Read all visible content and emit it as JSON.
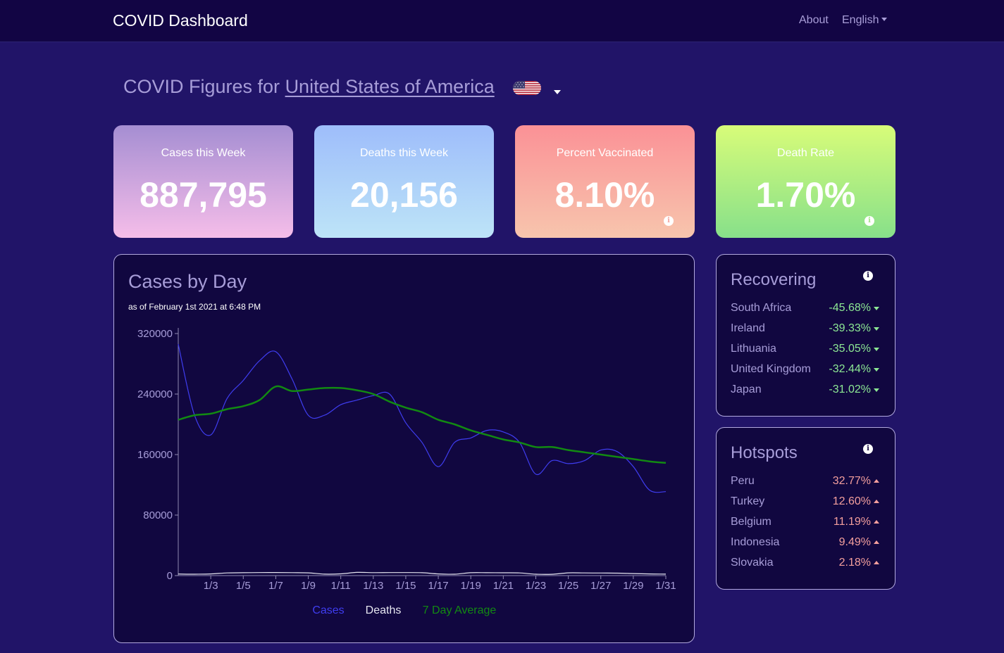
{
  "nav": {
    "brand": "COVID Dashboard",
    "about": "About",
    "language": "English"
  },
  "heading": {
    "prefix": "COVID Figures for ",
    "country": "United States of America",
    "flag_icon": "us-flag-icon"
  },
  "cards": {
    "cases": {
      "label": "Cases this Week",
      "value": "887,795"
    },
    "deaths": {
      "label": "Deaths this Week",
      "value": "20,156"
    },
    "vaccinated": {
      "label": "Percent Vaccinated",
      "value": "8.10%"
    },
    "death_rate": {
      "label": "Death Rate",
      "value": "1.70%"
    },
    "info_glyph": "i"
  },
  "chart_panel": {
    "title": "Cases by Day",
    "subtitle": "as of February 1st 2021 at 6:48 PM"
  },
  "chart_data": {
    "type": "line",
    "title": "Cases by Day",
    "x": [
      "1/1",
      "1/2",
      "1/3",
      "1/4",
      "1/5",
      "1/6",
      "1/7",
      "1/8",
      "1/9",
      "1/10",
      "1/11",
      "1/12",
      "1/13",
      "1/14",
      "1/15",
      "1/16",
      "1/17",
      "1/18",
      "1/19",
      "1/20",
      "1/21",
      "1/22",
      "1/23",
      "1/24",
      "1/25",
      "1/26",
      "1/27",
      "1/28",
      "1/29",
      "1/30",
      "1/31"
    ],
    "xticks": [
      "1/3",
      "1/5",
      "1/7",
      "1/9",
      "1/11",
      "1/13",
      "1/15",
      "1/17",
      "1/19",
      "1/21",
      "1/23",
      "1/25",
      "1/27",
      "1/29",
      "1/31"
    ],
    "yticks": [
      0,
      80000,
      160000,
      240000,
      320000
    ],
    "ylim": [
      0,
      320000
    ],
    "grid": false,
    "legend_position": "bottom",
    "series": [
      {
        "name": "Cases",
        "color": "#3f3df0",
        "values": [
          306000,
          212000,
          186000,
          234000,
          258000,
          284000,
          296000,
          260000,
          212000,
          212000,
          226000,
          232000,
          238000,
          240000,
          202000,
          176000,
          144000,
          176000,
          182000,
          192000,
          190000,
          176000,
          134000,
          152000,
          148000,
          152000,
          166000,
          164000,
          144000,
          113000,
          111000
        ]
      },
      {
        "name": "Deaths",
        "color": "#e6e6f0",
        "values": [
          2100,
          1900,
          2200,
          3500,
          3800,
          4000,
          4100,
          3900,
          3600,
          2000,
          2300,
          4300,
          3900,
          4000,
          4000,
          3800,
          2200,
          1900,
          3800,
          3800,
          3700,
          3500,
          1900,
          1800,
          3600,
          3500,
          3400,
          3300,
          2700,
          2200,
          2000
        ]
      },
      {
        "name": "7 Day Average",
        "color": "#128a12",
        "values": [
          206000,
          212000,
          214000,
          220000,
          224000,
          232000,
          250000,
          244000,
          246000,
          248000,
          248000,
          245000,
          240000,
          230000,
          222000,
          216000,
          206000,
          200000,
          192000,
          186000,
          180000,
          176000,
          170000,
          170000,
          166000,
          163000,
          160000,
          157000,
          154000,
          151000,
          149000
        ]
      }
    ]
  },
  "recovering": {
    "title": "Recovering",
    "items": [
      {
        "name": "South Africa",
        "pct": "-45.68%"
      },
      {
        "name": "Ireland",
        "pct": "-39.33%"
      },
      {
        "name": "Lithuania",
        "pct": "-35.05%"
      },
      {
        "name": "United Kingdom",
        "pct": "-32.44%"
      },
      {
        "name": "Japan",
        "pct": "-31.02%"
      }
    ]
  },
  "hotspots": {
    "title": "Hotspots",
    "items": [
      {
        "name": "Peru",
        "pct": "32.77%"
      },
      {
        "name": "Turkey",
        "pct": "12.60%"
      },
      {
        "name": "Belgium",
        "pct": "11.19%"
      },
      {
        "name": "Indonesia",
        "pct": "9.49%"
      },
      {
        "name": "Slovakia",
        "pct": "2.18%"
      }
    ]
  }
}
